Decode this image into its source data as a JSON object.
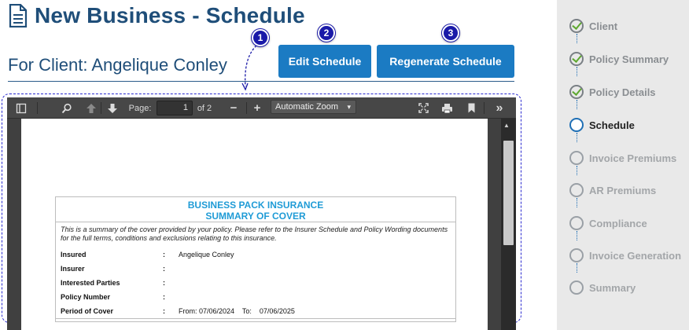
{
  "header": {
    "title": "New Business - Schedule",
    "client_line": "For Client: Angelique Conley"
  },
  "actions": {
    "edit_label": "Edit Schedule",
    "regenerate_label": "Regenerate Schedule"
  },
  "badges": [
    "1",
    "2",
    "3"
  ],
  "viewer": {
    "page_label": "Page:",
    "page_current": "1",
    "page_total": "of 2",
    "zoom": "Automatic Zoom",
    "icons": [
      "sidebar-toggle-icon",
      "search-icon",
      "previous-page-icon",
      "next-page-icon",
      "zoom-out-icon",
      "zoom-in-icon",
      "presentation-mode-icon",
      "print-icon",
      "bookmark-icon",
      "tools-icon"
    ]
  },
  "document": {
    "title_line1": "BUSINESS PACK INSURANCE",
    "title_line2": "SUMMARY OF COVER",
    "description": "This is a summary of the cover provided by your policy.  Please refer to the Insurer Schedule and Policy Wording documents for the full terms, conditions and exclusions relating to this insurance.",
    "rows": [
      {
        "label": "Insured",
        "colon": ":",
        "value": "Angelique Conley"
      },
      {
        "label": "Insurer",
        "colon": ":",
        "value": ""
      },
      {
        "label": "Interested Parties",
        "colon": ":",
        "value": ""
      },
      {
        "label": "Policy Number",
        "colon": ":",
        "value": ""
      },
      {
        "label": "Period of Cover",
        "colon": ":",
        "value": "From: 07/06/2024    To:    07/06/2025"
      }
    ]
  },
  "steps": [
    {
      "label": "Client",
      "state": "done"
    },
    {
      "label": "Policy Summary",
      "state": "done"
    },
    {
      "label": "Policy Details",
      "state": "done"
    },
    {
      "label": "Schedule",
      "state": "active"
    },
    {
      "label": "Invoice Premiums",
      "state": "pending"
    },
    {
      "label": "AR Premiums",
      "state": "pending"
    },
    {
      "label": "Compliance",
      "state": "pending"
    },
    {
      "label": "Invoice Generation",
      "state": "pending"
    },
    {
      "label": "Summary",
      "state": "pending"
    }
  ],
  "colors": {
    "title": "#1f4e79",
    "button": "#1b7bc3",
    "badge": "#1a1aa8",
    "doc_heading": "#1f9bd6",
    "check": "#5ea82f",
    "active_step": "#1f6fb5"
  }
}
